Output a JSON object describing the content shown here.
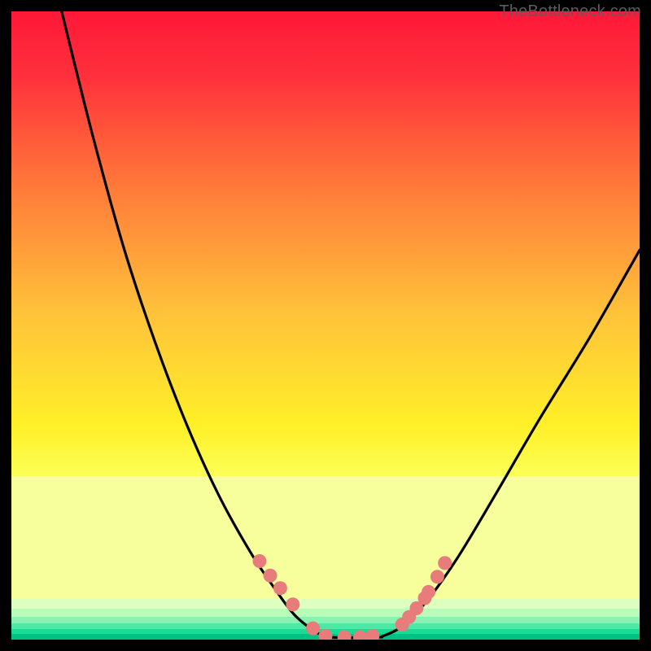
{
  "watermark": "TheBottleneck.com",
  "chart_data": {
    "type": "line",
    "title": "",
    "xlabel": "",
    "ylabel": "",
    "xlim": [
      0,
      100
    ],
    "ylim": [
      0,
      100
    ],
    "grid": false,
    "legend": false,
    "background_gradient": {
      "top_color": "#fe1838",
      "mid_color": "#fff200",
      "bottom_region_colors": [
        "#f7ff9d",
        "#d9ffb9",
        "#8cf5b6",
        "#00d692",
        "#00c083"
      ],
      "bottom_region_start_y": 74
    },
    "series": [
      {
        "name": "left-branch",
        "type": "line",
        "x": [
          8,
          13,
          18,
          23,
          28,
          33,
          38,
          42,
          45,
          48,
          50
        ],
        "y": [
          100,
          80,
          62,
          47,
          34,
          23,
          14,
          8,
          4,
          1.5,
          0.5
        ]
      },
      {
        "name": "valley-floor",
        "type": "line",
        "x": [
          50,
          53,
          56,
          59
        ],
        "y": [
          0.4,
          0.3,
          0.3,
          0.4
        ]
      },
      {
        "name": "right-branch",
        "type": "line",
        "x": [
          59,
          62,
          66,
          71,
          77,
          84,
          92,
          100
        ],
        "y": [
          0.5,
          2,
          6,
          13,
          23,
          35,
          48,
          62
        ]
      },
      {
        "name": "left-markers",
        "type": "scatter",
        "x": [
          39.5,
          41.2,
          42.8,
          44.8,
          48.0,
          50.0,
          53.0,
          55.5,
          57.5
        ],
        "y": [
          12.5,
          10.2,
          8.2,
          5.6,
          1.8,
          0.6,
          0.4,
          0.4,
          0.6
        ]
      },
      {
        "name": "right-markers",
        "type": "scatter",
        "x": [
          62.2,
          63.3,
          64.5,
          65.8,
          66.4,
          67.8,
          69.0
        ],
        "y": [
          2.4,
          3.6,
          5.0,
          6.6,
          7.6,
          10.0,
          12.2
        ]
      }
    ],
    "marker_color": "#e77c7a",
    "line_color": "#000000"
  }
}
